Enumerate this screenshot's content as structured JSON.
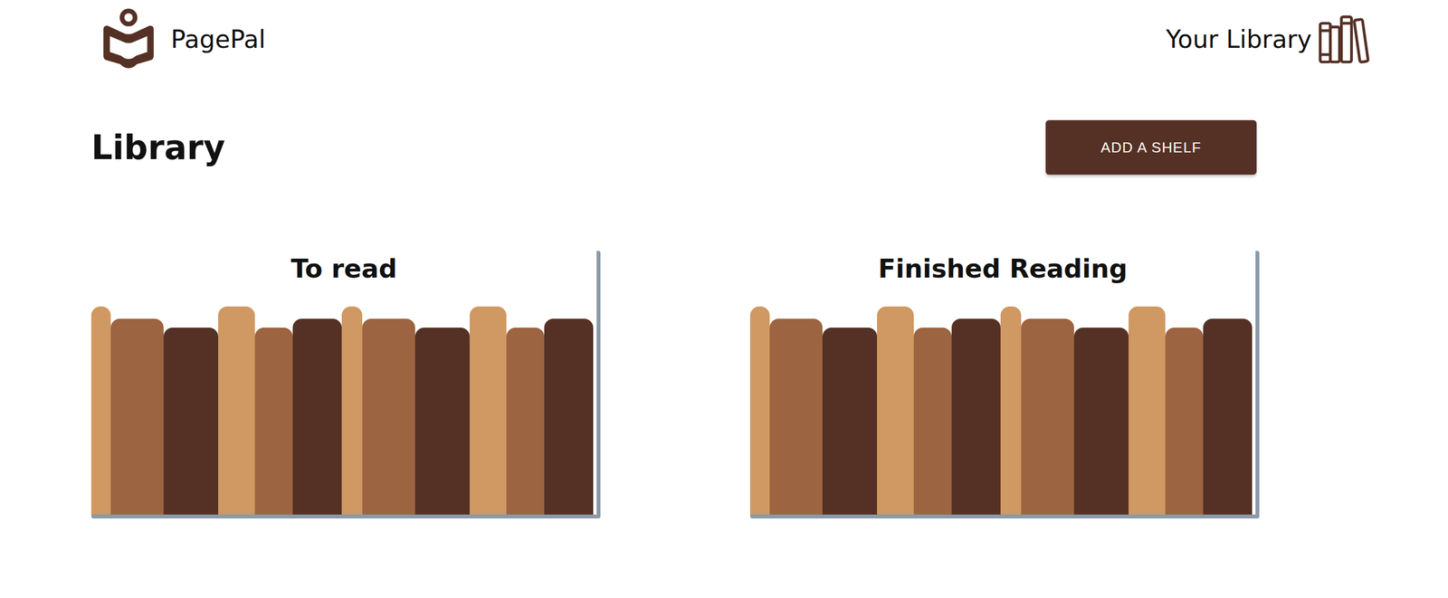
{
  "app": {
    "name": "PagePal"
  },
  "nav": {
    "label": "Your Library"
  },
  "page": {
    "title": "Library"
  },
  "buttons": [
    "ADD A SHELF"
  ],
  "shelves": [
    {
      "title": "To read",
      "books": [
        {
          "color": "#d09862"
        },
        {
          "color": "#9c6441"
        },
        {
          "color": "#553125"
        },
        {
          "color": "#d09862"
        },
        {
          "color": "#9c6441"
        },
        {
          "color": "#553125"
        },
        {
          "color": "#d09862"
        },
        {
          "color": "#9c6441"
        },
        {
          "color": "#553125"
        },
        {
          "color": "#d09862"
        },
        {
          "color": "#9c6441"
        },
        {
          "color": "#553125"
        }
      ]
    },
    {
      "title": "Finished Reading",
      "books": [
        {
          "color": "#d09862"
        },
        {
          "color": "#9c6441"
        },
        {
          "color": "#553125"
        },
        {
          "color": "#d09862"
        },
        {
          "color": "#9c6441"
        },
        {
          "color": "#553125"
        },
        {
          "color": "#d09862"
        },
        {
          "color": "#9c6441"
        },
        {
          "color": "#553125"
        },
        {
          "color": "#d09862"
        },
        {
          "color": "#9c6441"
        },
        {
          "color": "#553125"
        }
      ]
    }
  ]
}
